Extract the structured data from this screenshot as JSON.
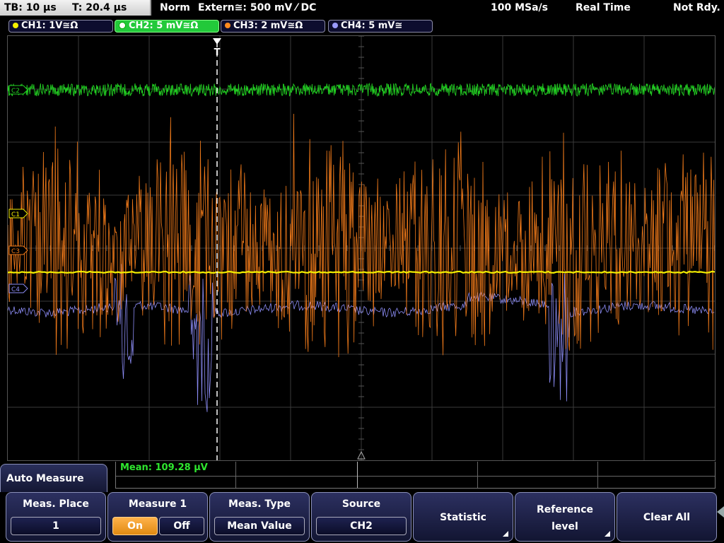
{
  "status": {
    "timebase": "TB: 10 µs",
    "trigger_time": "T: 20.4 µs",
    "trigger_mode": "Norm",
    "trigger_source": "Extern≅: 500 mV ⁄ DC",
    "sample_rate": "100 MSa/s",
    "acquisition_mode": "Real Time",
    "ready_state": "Not Rdy."
  },
  "channels": [
    {
      "label": "CH1: 1V≅Ω",
      "color": "#f5f000",
      "active": false
    },
    {
      "label": "CH2: 5 mV≅Ω",
      "color": "#26d926",
      "active": true
    },
    {
      "label": "CH3: 2 mV≅Ω",
      "color": "#ff8a1e",
      "active": false
    },
    {
      "label": "CH4: 5 mV≅",
      "color": "#8f8fff",
      "active": false
    }
  ],
  "markers": {
    "c1": "C1",
    "c2": "C2",
    "c3": "C3",
    "c4": "C4",
    "trigger": "T"
  },
  "measurement": {
    "result": "Mean: 109.28 µV"
  },
  "menu": {
    "title": "Auto Measure",
    "meas_place": {
      "label": "Meas. Place",
      "value": "1"
    },
    "measure1": {
      "label": "Measure 1",
      "on": "On",
      "off": "Off",
      "state": "on"
    },
    "meas_type": {
      "label": "Meas. Type",
      "value": "Mean Value"
    },
    "source": {
      "label": "Source",
      "value": "CH2"
    },
    "statistic": {
      "label": "Statistic"
    },
    "reference_level": {
      "label_line1": "Reference",
      "label_line2": "level"
    },
    "clear_all": {
      "label": "Clear All"
    }
  },
  "colors": {
    "ch1": "#f5f000",
    "ch2": "#22d022",
    "ch3": "#f07a1a",
    "ch4": "#8c8cf5",
    "grid": "#3a3a3a"
  }
}
